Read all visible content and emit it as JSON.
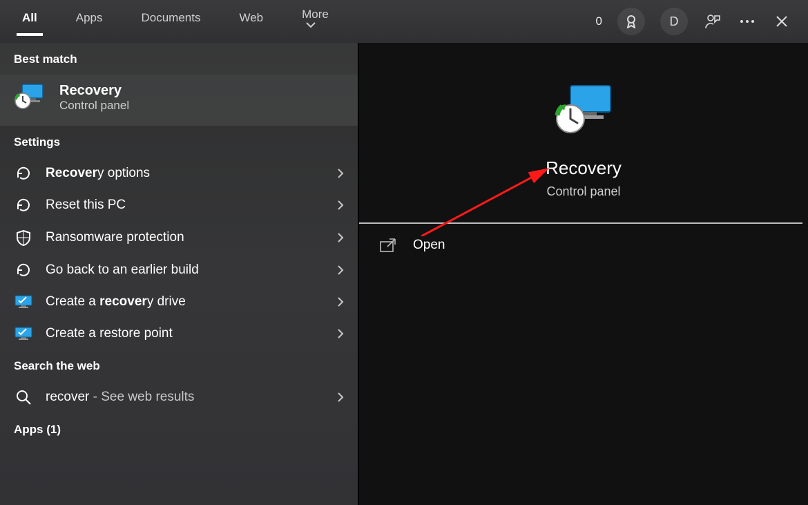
{
  "topbar": {
    "tabs": [
      "All",
      "Apps",
      "Documents",
      "Web",
      "More"
    ],
    "active_tab_index": 0,
    "rewards_count": "0",
    "user_initial": "D"
  },
  "left": {
    "best_match_header": "Best match",
    "best_match": {
      "title": "Recovery",
      "subtitle": "Control panel"
    },
    "settings_header": "Settings",
    "settings_items": [
      {
        "label_pre": "Recover",
        "label_bold": "",
        "label_post": "y options",
        "bold_front": true,
        "icon": "restore-icon"
      },
      {
        "label_pre": "Reset this PC",
        "label_bold": "",
        "label_post": "",
        "icon": "restore-icon"
      },
      {
        "label_pre": "Ransomware protection",
        "label_bold": "",
        "label_post": "",
        "icon": "shield-icon"
      },
      {
        "label_pre": "Go back to an earlier build",
        "label_bold": "",
        "label_post": "",
        "icon": "restore-icon"
      },
      {
        "label_pre": "Create a ",
        "label_bold": "recover",
        "label_post": "y drive",
        "icon": "monitor-icon"
      },
      {
        "label_pre": "Create a restore point",
        "label_bold": "",
        "label_post": "",
        "icon": "monitor-icon"
      }
    ],
    "web_header": "Search the web",
    "web_item": {
      "term": "recover",
      "suffix": " - See web results"
    },
    "apps_header": "Apps (1)"
  },
  "right": {
    "title": "Recovery",
    "subtitle": "Control panel",
    "open_action": "Open"
  }
}
